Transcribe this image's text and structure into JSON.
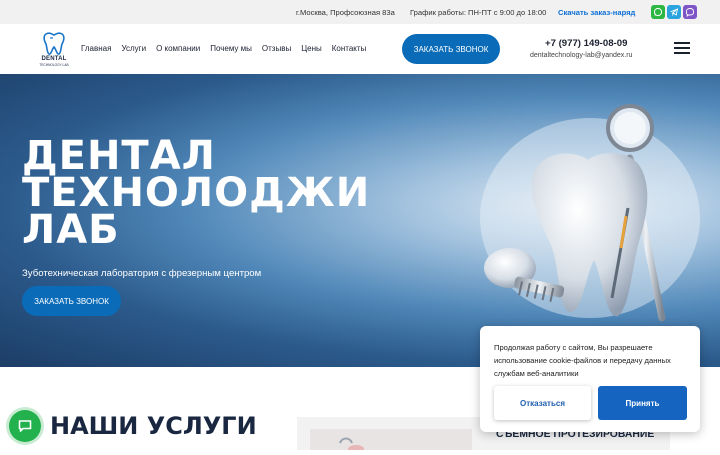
{
  "topbar": {
    "address": "г.Москва, Профсоюзная 83а",
    "hours": "График работы: ПН-ПТ с 9:00 до 18:00",
    "download_link": "Скачать заказ-наряд",
    "social_icons": [
      "whatsapp-icon",
      "telegram-icon",
      "viber-icon"
    ]
  },
  "header": {
    "logo_text": "DENTAL",
    "logo_sub": "TECHNOLOGY LAB",
    "nav": [
      "Главная",
      "Услуги",
      "О компании",
      "Почему мы",
      "Отзывы",
      "Цены",
      "Контакты"
    ],
    "call_button": "ЗАКАЗАТЬ ЗВОНОК",
    "phone": "+7 (977) 149-08-09",
    "email": "dentaltechnology-lab@yandex.ru"
  },
  "hero": {
    "title": "ДЕНТАЛ\nТЕХНОЛОДЖИ\nЛАБ",
    "subtitle": "Зуботехническая лаборатория с фрезерным центром",
    "button": "ЗАКАЗАТЬ ЗВОНОК"
  },
  "cookie": {
    "text": "Продолжая работу с сайтом, Вы разрешаете использование cookie-файлов и передачу данных службам веб-аналитики",
    "decline": "Отказаться",
    "accept": "Принять"
  },
  "services": {
    "heading": "НАШИ УСЛУГИ",
    "card_title": "СЪЕМНОЕ ПРОТЕЗИРОВАНИЕ"
  },
  "colors": {
    "accent": "#0a6cb8",
    "accept_button": "#1565c0",
    "chat_button": "#22b14c"
  }
}
